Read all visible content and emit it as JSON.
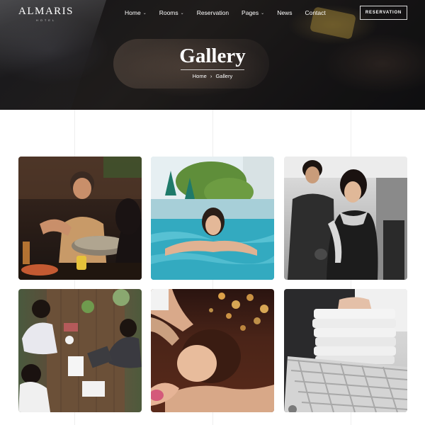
{
  "brand": {
    "name": "ALMARIS",
    "tagline": "HOTEL"
  },
  "nav": {
    "items": [
      {
        "label": "Home",
        "has_dropdown": true
      },
      {
        "label": "Rooms",
        "has_dropdown": true
      },
      {
        "label": "Reservation",
        "has_dropdown": false
      },
      {
        "label": "Pages",
        "has_dropdown": true
      },
      {
        "label": "News",
        "has_dropdown": false
      },
      {
        "label": "Contact",
        "has_dropdown": false
      }
    ],
    "dropdown_glyph": "⌄",
    "reservation_button": "RESERVATION"
  },
  "hero": {
    "title": "Gallery",
    "breadcrumb": [
      "Home",
      "Gallery"
    ],
    "breadcrumb_separator": "›"
  },
  "gallery": {
    "images": [
      {
        "subject": "restaurant-dining"
      },
      {
        "subject": "swimming-pool"
      },
      {
        "subject": "fitness-gym"
      },
      {
        "subject": "business-meeting"
      },
      {
        "subject": "spa-massage"
      },
      {
        "subject": "laundry-towels"
      }
    ]
  }
}
